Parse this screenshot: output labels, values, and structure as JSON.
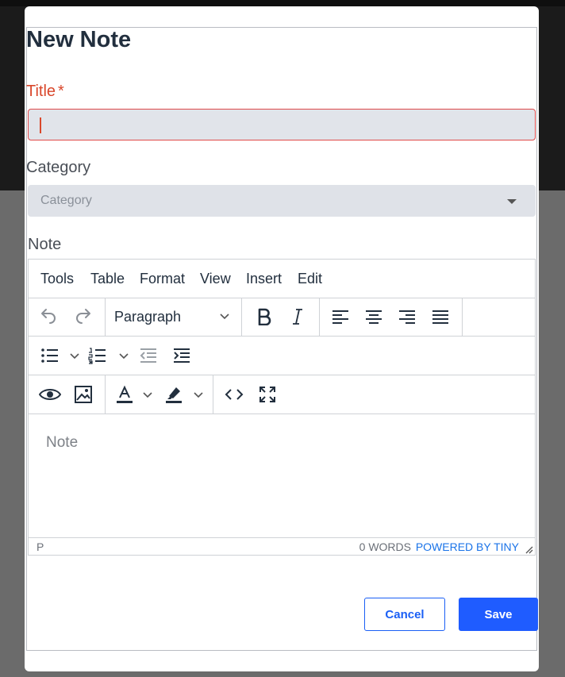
{
  "dialog": {
    "title": "New Note"
  },
  "fields": {
    "title_label": "Title",
    "required_mark": "*",
    "title_value": "",
    "category_label": "Category",
    "category_placeholder": "Category",
    "note_label": "Note"
  },
  "editor": {
    "menu": [
      "Tools",
      "Table",
      "Format",
      "View",
      "Insert",
      "Edit"
    ],
    "block_format": "Paragraph",
    "placeholder": "Note",
    "status_path": "P",
    "word_count": "0 WORDS",
    "powered_by": "POWERED BY TINY"
  },
  "buttons": {
    "cancel": "Cancel",
    "save": "Save"
  },
  "colors": {
    "accent": "#1f5cff",
    "error": "#d9472b"
  },
  "icons": [
    "undo-icon",
    "redo-icon",
    "bold-icon",
    "italic-icon",
    "align-left-icon",
    "align-center-icon",
    "align-right-icon",
    "align-justify-icon",
    "bullet-list-icon",
    "numbered-list-icon",
    "outdent-icon",
    "indent-icon",
    "preview-icon",
    "image-icon",
    "text-color-icon",
    "highlight-icon",
    "code-icon",
    "fullscreen-icon"
  ]
}
